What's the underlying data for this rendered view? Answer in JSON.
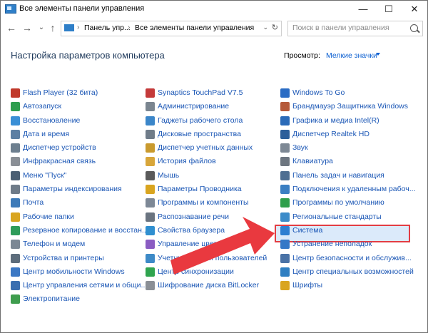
{
  "window": {
    "title": "Все элементы панели управления",
    "controls": {
      "minimize": "—",
      "maximize": "☐",
      "close": "✕"
    }
  },
  "nav": {
    "back": "←",
    "forward": "→",
    "history": "⌄",
    "up": "↑"
  },
  "address": {
    "crumb1": "Панель упр...",
    "sep": "›",
    "crumb2": "Все элементы панели управления",
    "dropdown": "⌄",
    "refresh": "↻"
  },
  "search": {
    "placeholder": "Поиск в панели управления"
  },
  "heading": "Настройка параметров компьютера",
  "view": {
    "label": "Просмотр:",
    "value": "Мелкие значки"
  },
  "columns": [
    {
      "items": [
        {
          "label": "Flash Player (32 бита)",
          "icon": "flash-icon",
          "color": "#c0392b"
        },
        {
          "label": "Автозапуск",
          "icon": "autoplay-icon",
          "color": "#2e9e4f"
        },
        {
          "label": "Восстановление",
          "icon": "recovery-icon",
          "color": "#3a8fd6"
        },
        {
          "label": "Дата и время",
          "icon": "clock-icon",
          "color": "#5c7fa3"
        },
        {
          "label": "Диспетчер устройств",
          "icon": "device-manager-icon",
          "color": "#6d7f8f"
        },
        {
          "label": "Инфракрасная связь",
          "icon": "infrared-icon",
          "color": "#8a8f96"
        },
        {
          "label": "Меню \"Пуск\"",
          "icon": "start-menu-icon",
          "color": "#4b5f73"
        },
        {
          "label": "Параметры индексирования",
          "icon": "indexing-icon",
          "color": "#6e7b88"
        },
        {
          "label": "Почта",
          "icon": "mail-icon",
          "color": "#3d7ab8"
        },
        {
          "label": "Рабочие папки",
          "icon": "work-folders-icon",
          "color": "#d9a520"
        },
        {
          "label": "Резервное копирование и восстан...",
          "icon": "backup-icon",
          "color": "#2f9c5a"
        },
        {
          "label": "Телефон и модем",
          "icon": "phone-icon",
          "color": "#7b8794"
        },
        {
          "label": "Устройства и принтеры",
          "icon": "printer-icon",
          "color": "#5d6d7c"
        },
        {
          "label": "Центр мобильности Windows",
          "icon": "mobility-icon",
          "color": "#3c78c4"
        },
        {
          "label": "Центр управления сетями и общи...",
          "icon": "network-icon",
          "color": "#3a6fb0"
        },
        {
          "label": "Электропитание",
          "icon": "power-icon",
          "color": "#3f9d4e"
        }
      ]
    },
    {
      "items": [
        {
          "label": "Synaptics TouchPad V7.5",
          "icon": "touchpad-icon",
          "color": "#c43a3a"
        },
        {
          "label": "Администрирование",
          "icon": "admin-tools-icon",
          "color": "#7a8590"
        },
        {
          "label": "Гаджеты рабочего стола",
          "icon": "gadgets-icon",
          "color": "#3b86c9"
        },
        {
          "label": "Дисковые пространства",
          "icon": "storage-spaces-icon",
          "color": "#6f7c89"
        },
        {
          "label": "Диспетчер учетных данных",
          "icon": "credential-icon",
          "color": "#c99a2e"
        },
        {
          "label": "История файлов",
          "icon": "file-history-icon",
          "color": "#d8a63a"
        },
        {
          "label": "Мышь",
          "icon": "mouse-icon",
          "color": "#5a5a5a"
        },
        {
          "label": "Параметры Проводника",
          "icon": "explorer-options-icon",
          "color": "#d9a520"
        },
        {
          "label": "Программы и компоненты",
          "icon": "programs-icon",
          "color": "#7d8896"
        },
        {
          "label": "Распознавание речи",
          "icon": "microphone-icon",
          "color": "#6a7480"
        },
        {
          "label": "Свойства браузера",
          "icon": "internet-options-icon",
          "color": "#2f8fd0"
        },
        {
          "label": "Управление цветом",
          "icon": "color-management-icon",
          "color": "#8a5cc2"
        },
        {
          "label": "Учетные записи пользователей",
          "icon": "user-accounts-icon",
          "color": "#3d8ac7"
        },
        {
          "label": "Центр синхронизации",
          "icon": "sync-center-icon",
          "color": "#2fa44f"
        },
        {
          "label": "Шифрование диска BitLocker",
          "icon": "bitlocker-icon",
          "color": "#8a8f96"
        }
      ]
    },
    {
      "items": [
        {
          "label": "Windows To Go",
          "icon": "windows-to-go-icon",
          "color": "#2b6cc4"
        },
        {
          "label": "Брандмауэр Защитника Windows",
          "icon": "firewall-icon",
          "color": "#b55a3a"
        },
        {
          "label": "Графика и медиа Intel(R)",
          "icon": "intel-graphics-icon",
          "color": "#2a6ab8"
        },
        {
          "label": "Диспетчер Realtek HD",
          "icon": "realtek-icon",
          "color": "#2d5f9a"
        },
        {
          "label": "Звук",
          "icon": "sound-icon",
          "color": "#7d8894"
        },
        {
          "label": "Клавиатура",
          "icon": "keyboard-icon",
          "color": "#6d7680"
        },
        {
          "label": "Панель задач и навигация",
          "icon": "taskbar-icon",
          "color": "#4f6f92"
        },
        {
          "label": "Подключения к удаленным рабоч...",
          "icon": "remote-desktop-icon",
          "color": "#3b7fc2"
        },
        {
          "label": "Программы по умолчанию",
          "icon": "default-programs-icon",
          "color": "#2f9f4c"
        },
        {
          "label": "Региональные стандарты",
          "icon": "region-icon",
          "color": "#3c8bc9"
        },
        {
          "label": "Система",
          "icon": "system-icon",
          "color": "#2e7fd1"
        },
        {
          "label": "Устранение неполадок",
          "icon": "troubleshoot-icon",
          "color": "#3478c7"
        },
        {
          "label": "Центр безопасности и обслужив...",
          "icon": "security-center-icon",
          "color": "#4a72a6"
        },
        {
          "label": "Центр специальных возможностей",
          "icon": "ease-of-access-icon",
          "color": "#2f7fc2"
        },
        {
          "label": "Шрифты",
          "icon": "fonts-icon",
          "color": "#d9a520"
        }
      ]
    }
  ],
  "highlight": {
    "border_color": "#e33d44",
    "fill_color": "#dbeafa"
  },
  "arrow": {
    "color": "#e9393f"
  }
}
